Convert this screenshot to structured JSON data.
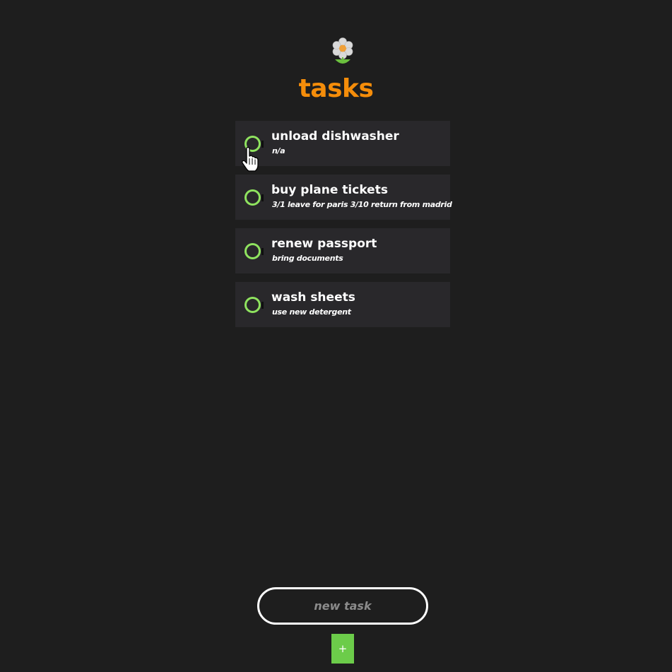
{
  "app": {
    "logo_icon": "flower-icon",
    "title": "tasks",
    "accent_color": "#f58d0a",
    "checkbox_color": "#8fe35f"
  },
  "tasks": [
    {
      "title": "unload dishwasher",
      "note": "n/a",
      "done": false
    },
    {
      "title": "buy plane tickets",
      "note": "3/1 leave for paris 3/10 return from madrid",
      "done": false
    },
    {
      "title": "renew passport",
      "note": "bring documents",
      "done": false
    },
    {
      "title": "wash sheets",
      "note": "use new detergent",
      "done": false
    }
  ],
  "new_task": {
    "placeholder": "new task",
    "value": ""
  },
  "add_button": {
    "label": "+",
    "color": "#6ccc4a"
  }
}
